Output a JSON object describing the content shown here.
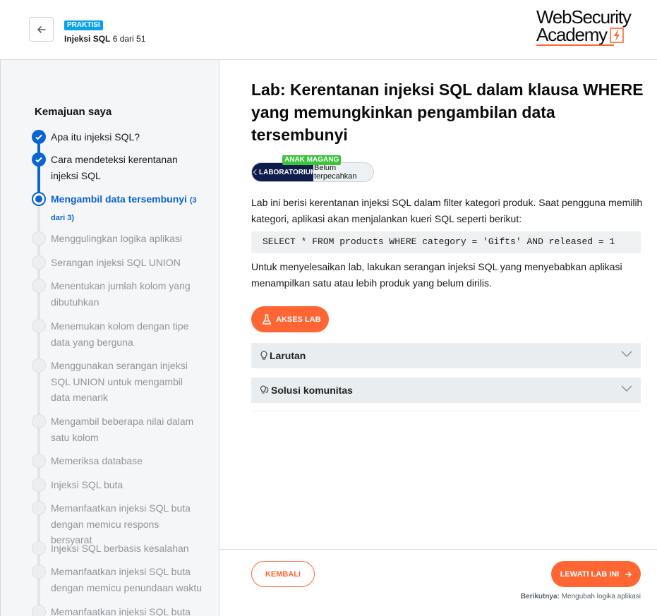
{
  "header": {
    "badge": "PRAKTISI",
    "topic": "Injeksi SQL",
    "progress": "6 dari 51",
    "logo_line1": "WebSecurity",
    "logo_line2": "Academy",
    "accent": "#ff6633"
  },
  "sidebar": {
    "title": "Kemajuan saya",
    "items": [
      {
        "label": "Apa itu injeksi SQL?",
        "state": "done"
      },
      {
        "label": "Cara mendeteksi kerentanan injeksi SQL",
        "state": "done"
      },
      {
        "label": "Mengambil data tersembunyi",
        "count": "(3 dari 3)",
        "state": "current"
      },
      {
        "label": "Menggulingkan logika aplikasi",
        "state": "todo"
      },
      {
        "label": "Serangan injeksi SQL UNION",
        "state": "todo"
      },
      {
        "label": "Menentukan jumlah kolom yang dibutuhkan",
        "state": "todo"
      },
      {
        "label": "Menemukan kolom dengan tipe data yang berguna",
        "state": "todo"
      },
      {
        "label": "Menggunakan serangan injeksi SQL UNION untuk mengambil data menarik",
        "state": "todo"
      },
      {
        "label": "Mengambil beberapa nilai dalam satu kolom",
        "state": "todo"
      },
      {
        "label": "Memeriksa database",
        "state": "todo"
      },
      {
        "label": "Injeksi SQL buta",
        "state": "todo"
      },
      {
        "label": "Memanfaatkan injeksi SQL buta dengan memicu respons bersyarat",
        "state": "todo"
      },
      {
        "label": "Injeksi SQL berbasis kesalahan",
        "state": "todo"
      },
      {
        "label": "Memanfaatkan injeksi SQL buta dengan memicu penundaan waktu",
        "state": "todo"
      },
      {
        "label": "Memanfaatkan injeksi SQL buta",
        "state": "todo"
      }
    ]
  },
  "main": {
    "title": "Lab: Kerentanan injeksi SQL dalam klausa WHERE yang memungkinkan pengambilan data tersembunyi",
    "level_badge": "ANAK MAGANG",
    "lab_tag": "LABORATORIUM",
    "status": "Belum terpecahkan",
    "description": "Lab ini berisi kerentanan injeksi SQL dalam filter kategori produk. Saat pengguna memilih kategori, aplikasi akan menjalankan kueri SQL seperti berikut:",
    "code": "SELECT * FROM products WHERE category = 'Gifts' AND released = 1",
    "instruction": "Untuk menyelesaikan lab, lakukan serangan injeksi SQL yang menyebabkan aplikasi menampilkan satu atau lebih produk yang belum dirilis.",
    "access_button": "AKSES LAB",
    "accordions": [
      "Larutan",
      "Solusi komunitas"
    ]
  },
  "footer": {
    "back_button": "KEMBALI",
    "skip_button": "LEWATI LAB INI",
    "next_label": "Berikutnya:",
    "next_title": "Mengubah logika aplikasi"
  }
}
